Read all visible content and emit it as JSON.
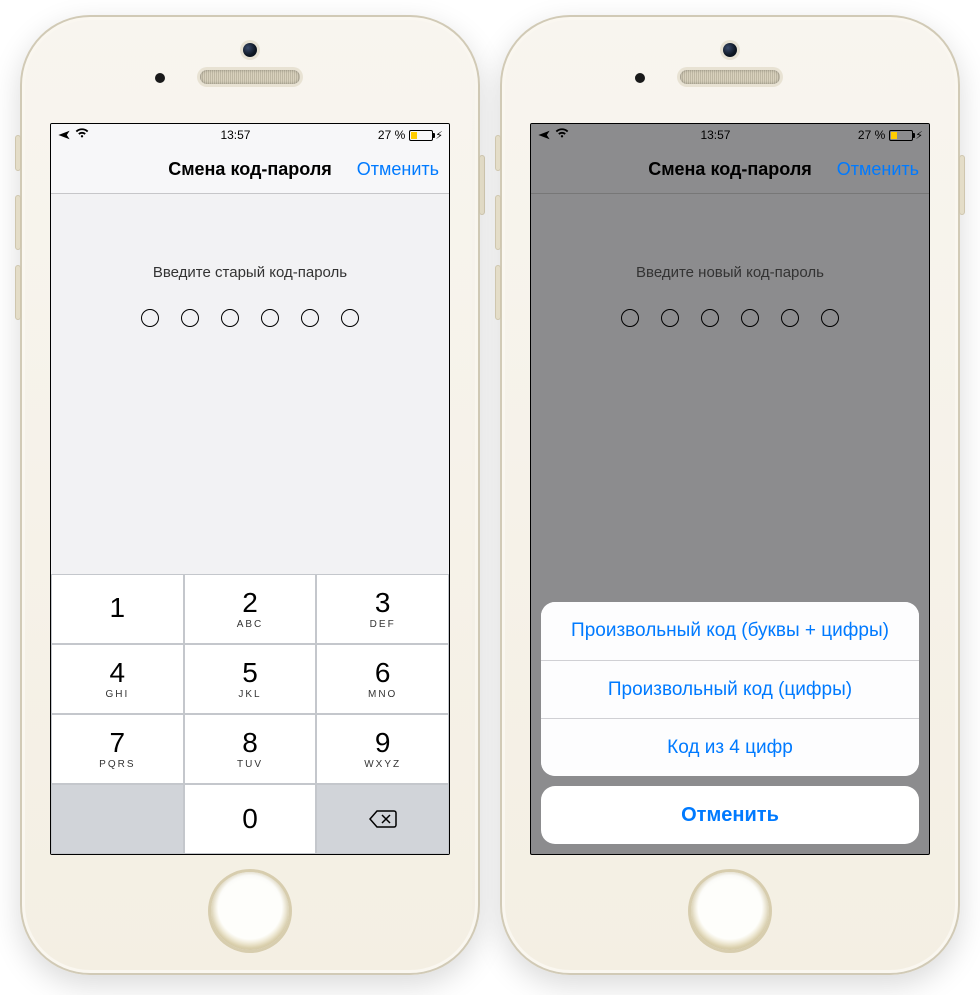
{
  "status": {
    "time": "13:57",
    "battery_text": "27 %",
    "battery_pct": 27
  },
  "phone1": {
    "nav_title": "Смена код-пароля",
    "nav_cancel": "Отменить",
    "prompt": "Введите старый код-пароль",
    "keypad": [
      {
        "n": "1",
        "l": ""
      },
      {
        "n": "2",
        "l": "ABC"
      },
      {
        "n": "3",
        "l": "DEF"
      },
      {
        "n": "4",
        "l": "GHI"
      },
      {
        "n": "5",
        "l": "JKL"
      },
      {
        "n": "6",
        "l": "MNO"
      },
      {
        "n": "7",
        "l": "PQRS"
      },
      {
        "n": "8",
        "l": "TUV"
      },
      {
        "n": "9",
        "l": "WXYZ"
      },
      {
        "n": "0",
        "l": ""
      }
    ]
  },
  "phone2": {
    "nav_title": "Смена код-пароля",
    "nav_cancel": "Отменить",
    "prompt": "Введите новый код-пароль",
    "sheet": {
      "opts": [
        "Произвольный код (буквы + цифры)",
        "Произвольный код (цифры)",
        "Код из 4 цифр"
      ],
      "cancel": "Отменить"
    }
  }
}
